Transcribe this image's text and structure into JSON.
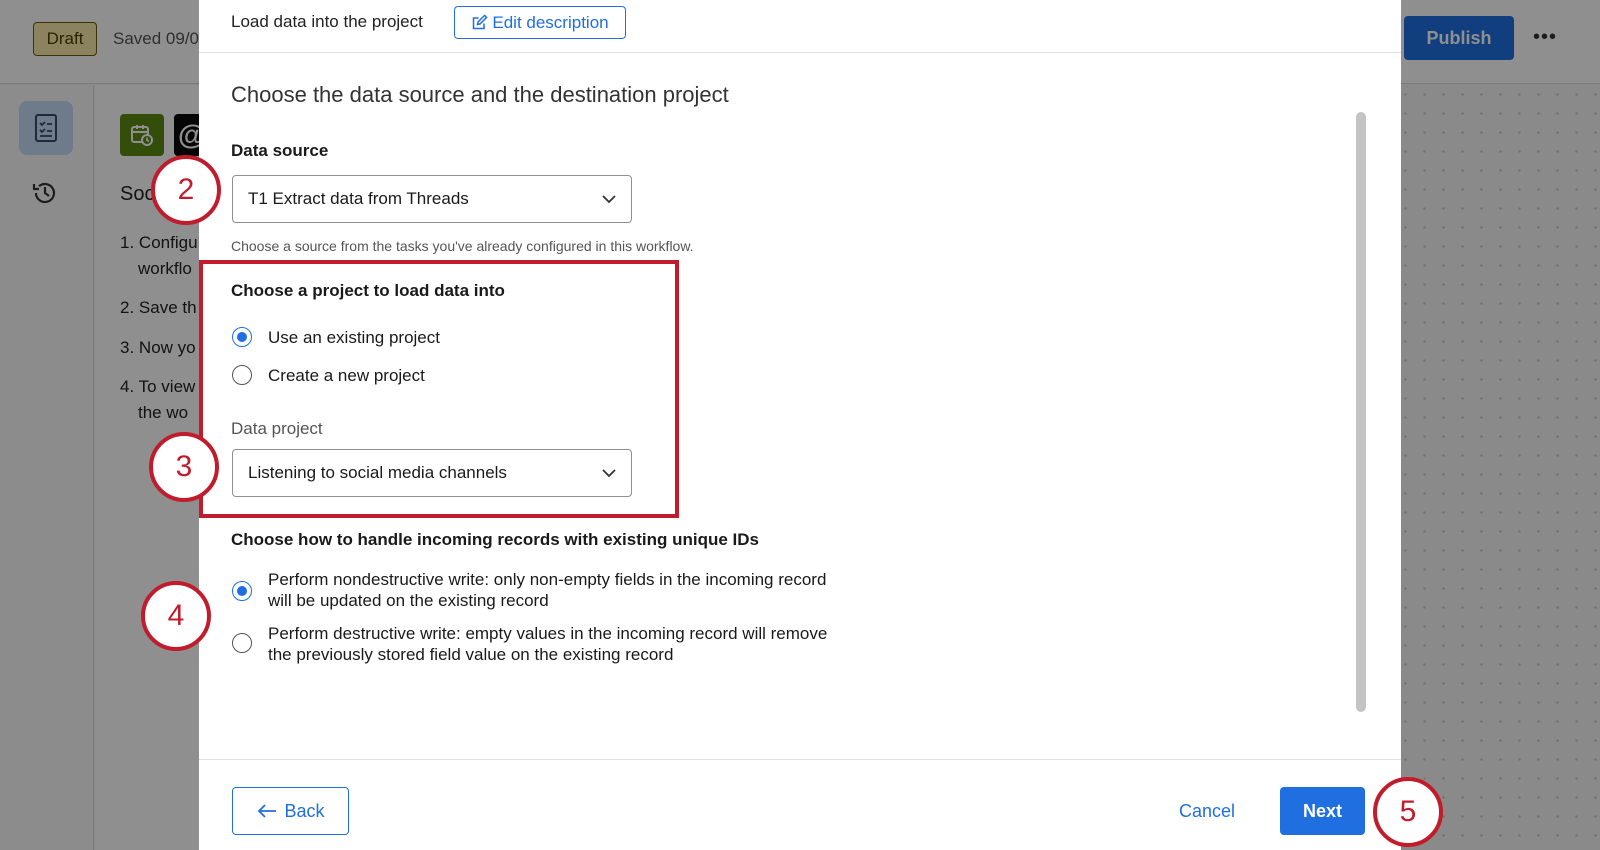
{
  "background_app": {
    "draft_badge": "Draft",
    "saved_text": "Saved 09/0",
    "publish_label": "Publish",
    "more_label": "•••",
    "heading_partial": "Soc",
    "steps_partial": [
      {
        "num": "1.",
        "line1": "Configu",
        "line2": "workflo"
      },
      {
        "num": "2.",
        "line1": "Save th",
        "line2": ""
      },
      {
        "num": "3.",
        "line1": "Now yo",
        "line2": ""
      },
      {
        "num": "4.",
        "line1": "To view",
        "line2": "the wo"
      }
    ]
  },
  "modal": {
    "title": "Load data into the project",
    "edit_description_label": "Edit description",
    "section_title": "Choose the data source and the destination project",
    "data_source": {
      "label": "Data source",
      "selected": "T1 Extract data from Threads",
      "helper": "Choose a source from the tasks you've already configured in this workflow."
    },
    "project_choice": {
      "label": "Choose a project to load data into",
      "options": [
        {
          "label": "Use an existing project",
          "checked": true
        },
        {
          "label": "Create a new project",
          "checked": false
        }
      ],
      "data_project_label": "Data project",
      "data_project_selected": "Listening to social media channels"
    },
    "records_handling": {
      "label": "Choose how to handle incoming records with existing unique IDs",
      "options": [
        {
          "label": "Perform nondestructive write: only non-empty fields in the incoming record will be updated on the existing record",
          "checked": true
        },
        {
          "label": "Perform destructive write: empty values in the incoming record will remove the previously stored field value on the existing record",
          "checked": false
        }
      ]
    },
    "footer": {
      "back_label": "Back",
      "cancel_label": "Cancel",
      "next_label": "Next"
    }
  },
  "callouts": [
    "2",
    "3",
    "4",
    "5"
  ],
  "colors": {
    "accent": "#1f6fe0",
    "annotation_red": "#c01c2c",
    "draft_badge_bg": "#f7e9a6"
  }
}
